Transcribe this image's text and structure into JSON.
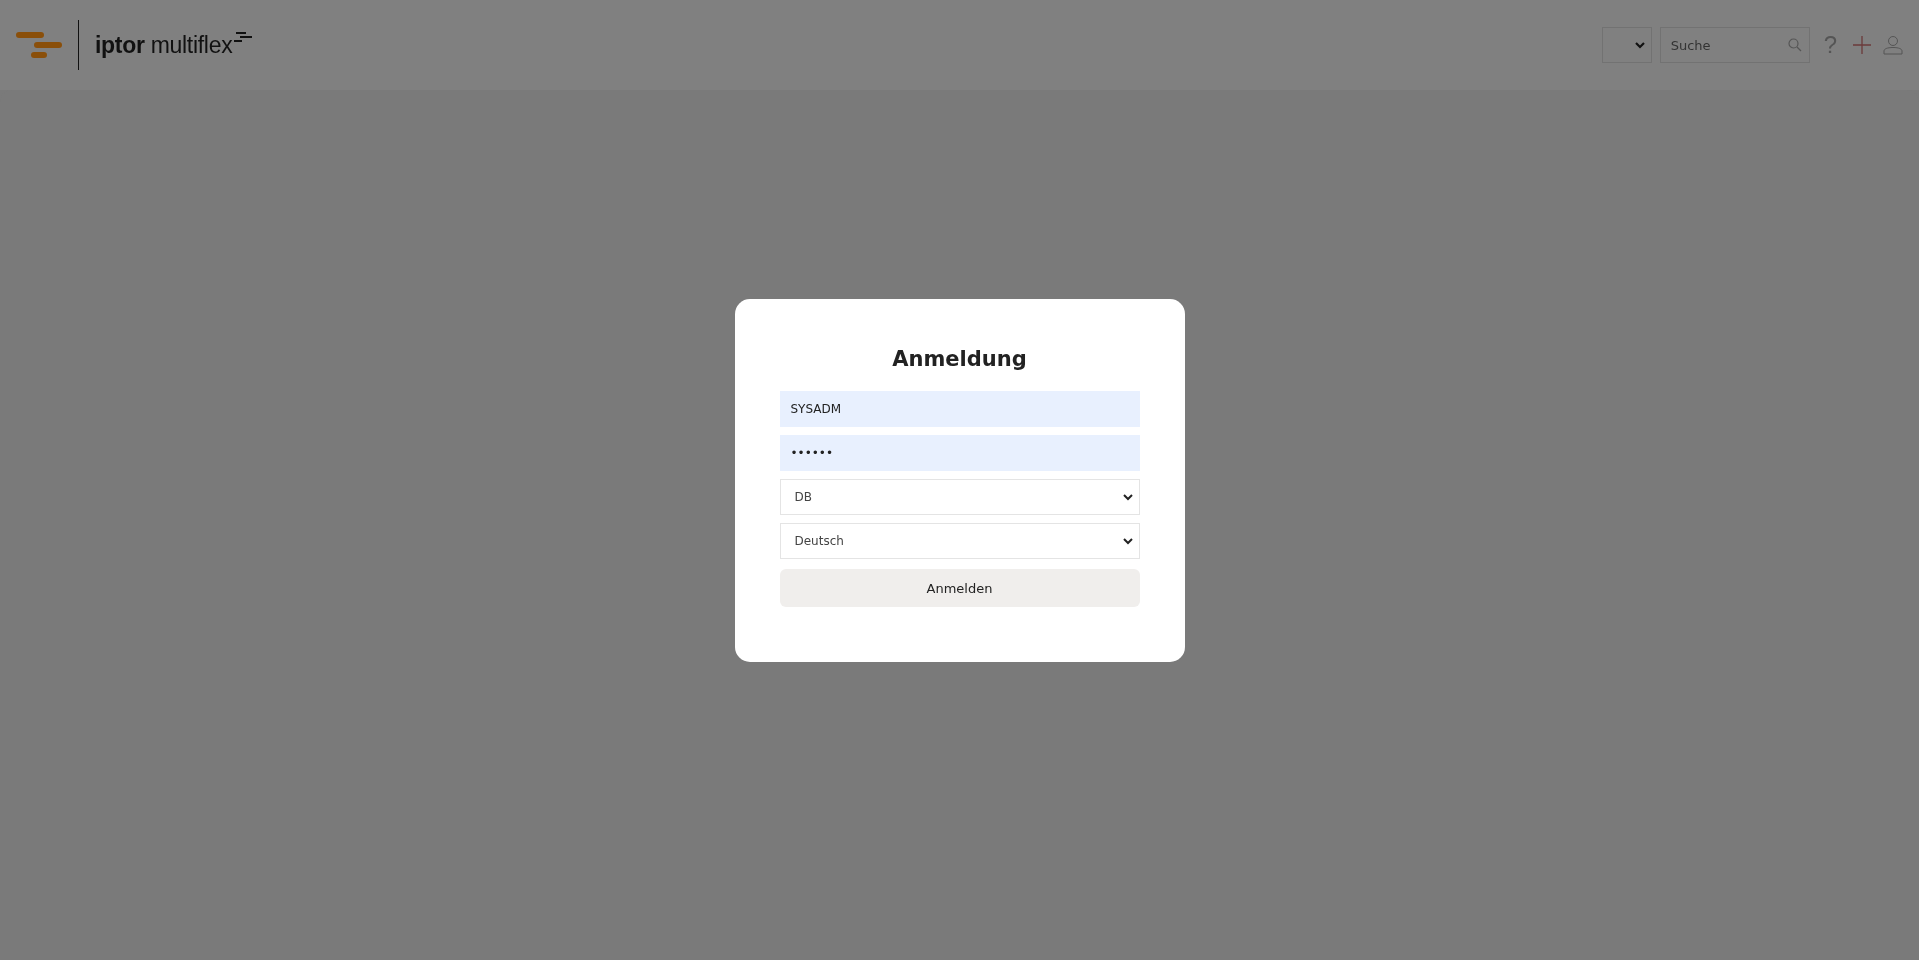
{
  "header": {
    "logo_text": "**iptor** multiflex",
    "search": {
      "placeholder": "Suche"
    },
    "help_label": "?"
  },
  "login": {
    "title": "Anmeldung",
    "username": "SYSADM",
    "password": "••••••",
    "database": "DB",
    "language": "Deutsch",
    "submit": "Anmelden"
  }
}
